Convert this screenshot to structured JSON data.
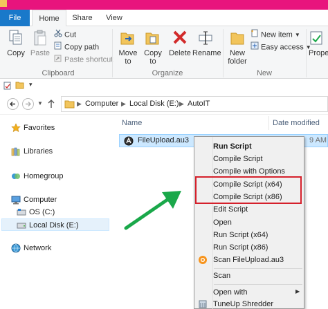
{
  "ribbon": {
    "tabs": {
      "file": "File",
      "home": "Home",
      "share": "Share",
      "view": "View"
    },
    "clipboard": {
      "copy": "Copy",
      "paste": "Paste",
      "cut": "Cut",
      "copy_path": "Copy path",
      "paste_shortcut": "Paste shortcut",
      "group_label": "Clipboard"
    },
    "organize": {
      "move_to_line1": "Move",
      "move_to_line2": "to",
      "copy_to_line1": "Copy",
      "copy_to_line2": "to",
      "delete": "Delete",
      "rename": "Rename",
      "group_label": "Organize"
    },
    "new": {
      "new_folder_line1": "New",
      "new_folder_line2": "folder",
      "new_item": "New item",
      "easy_access": "Easy access",
      "group_label": "New"
    },
    "open": {
      "properties": "Prope"
    }
  },
  "address": {
    "crumbs": [
      "Computer",
      "Local Disk (E:)",
      "AutoIT"
    ]
  },
  "nav": {
    "favorites": "Favorites",
    "libraries": "Libraries",
    "homegroup": "Homegroup",
    "computer": "Computer",
    "os_c": "OS (C:)",
    "local_disk_e": "Local Disk (E:)",
    "network": "Network"
  },
  "content": {
    "columns": {
      "name": "Name",
      "date_modified": "Date modified"
    },
    "file": {
      "name": "FileUpload.au3",
      "date": "9 AM"
    }
  },
  "context_menu": {
    "items": [
      "Run Script",
      "Compile Script",
      "Compile with Options",
      "Compile Script (x64)",
      "Compile Script (x86)",
      "Edit Script",
      "Open",
      "Run Script (x64)",
      "Run Script (x86)",
      "Scan FileUpload.au3",
      "Scan",
      "Open with",
      "TuneUp Shredder"
    ]
  },
  "colors": {
    "file_tab": "#1979ca",
    "title_strip": "#e8147d",
    "highlight_box": "#d5202b",
    "arrow": "#1aa84a",
    "selection": "#cce8ff"
  }
}
